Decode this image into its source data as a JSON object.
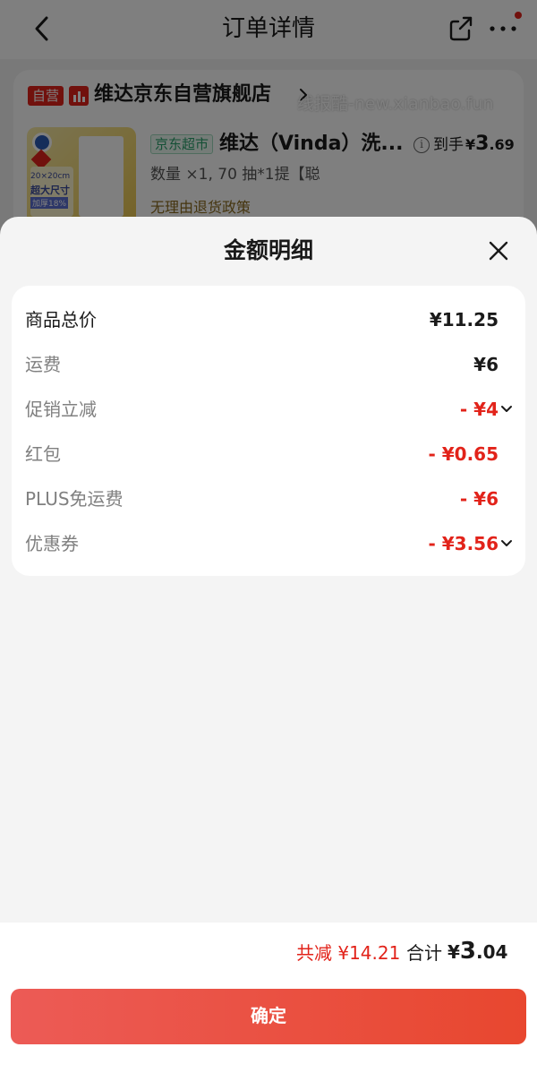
{
  "nav": {
    "title": "订单详情"
  },
  "store": {
    "self_tag": "自营",
    "name": "维达京东自营旗舰店"
  },
  "product": {
    "channel_tag": "京东超市",
    "name": "维达（Vinda）洗...",
    "arrive_label": "到手",
    "arrive_currency": "¥",
    "arrive_int": "3",
    "arrive_dec": ".69",
    "spec": "数量 ×1, 70 抽*1提【聪",
    "return_policy": "无理由退货政策",
    "image_text": {
      "size": "20×20cm",
      "big": "超大尺寸",
      "thick": "加厚18%"
    }
  },
  "watermark": "线报酷-new.xianbao.fun",
  "sheet": {
    "title": "金额明细",
    "rows": [
      {
        "label": "商品总价",
        "value": "¥11.25"
      },
      {
        "label": "运费",
        "value": "¥6"
      },
      {
        "label": "促销立减",
        "value": "- ¥4"
      },
      {
        "label": "红包",
        "value": "- ¥0.65"
      },
      {
        "label": "PLUS免运费",
        "value": "- ¥6"
      },
      {
        "label": "优惠券",
        "value": "- ¥3.56"
      }
    ]
  },
  "summary": {
    "saving": "共减 ¥14.21",
    "total_label": "合计",
    "total_currency": "¥",
    "total_int": "3",
    "total_dec": ".04"
  },
  "confirm_label": "确定",
  "colors": {
    "accent_red": "#e2231a",
    "jd_green": "#2ba16d",
    "button_start": "#ec5b56",
    "button_end": "#e8472f"
  },
  "icons": [
    "back-arrow-icon",
    "share-icon",
    "more-icon",
    "store-chart-icon",
    "chevron-right-icon",
    "info-icon",
    "close-icon",
    "chevron-down-icon"
  ]
}
